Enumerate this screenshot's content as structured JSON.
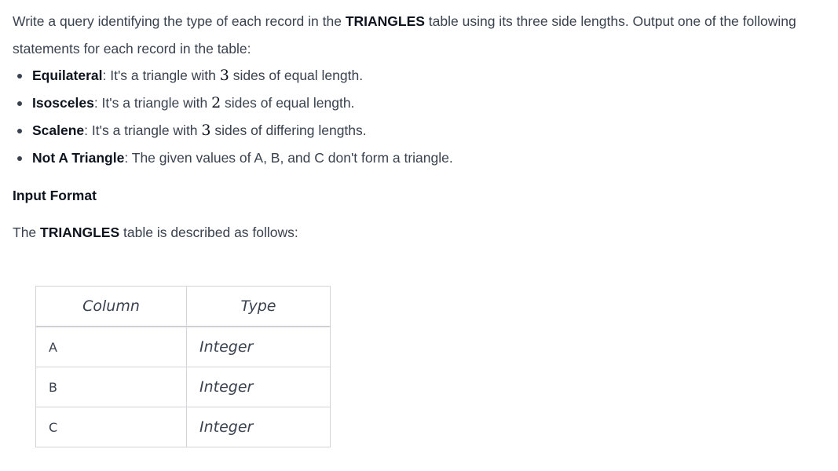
{
  "intro": {
    "text_before": "Write a query identifying the type of each record in the ",
    "table_name": "TRIANGLES",
    "text_after": " table using its three side lengths. Output one of the following statements for each record in the table:"
  },
  "types": [
    {
      "name": "Equilateral",
      "sep": ": ",
      "desc_before": "It's a triangle with ",
      "number": "3",
      "desc_after": " sides of equal length."
    },
    {
      "name": "Isosceles",
      "sep": ": ",
      "desc_before": "It's a triangle with ",
      "number": "2",
      "desc_after": " sides of equal length."
    },
    {
      "name": "Scalene",
      "sep": ": ",
      "desc_before": "It's a triangle with ",
      "number": "3",
      "desc_after": " sides of differing lengths."
    },
    {
      "name": "Not A Triangle",
      "sep": ": ",
      "desc_before": "The given values of A, B, and C don't form a triangle.",
      "number": "",
      "desc_after": ""
    }
  ],
  "input_format": {
    "heading": "Input Format",
    "desc_before": "The ",
    "table_name": "TRIANGLES",
    "desc_after": " table is described as follows:"
  },
  "schema_table": {
    "headers": [
      "Column",
      "Type"
    ],
    "rows": [
      {
        "column": "A",
        "type": "Integer"
      },
      {
        "column": "B",
        "type": "Integer"
      },
      {
        "column": "C",
        "type": "Integer"
      }
    ]
  }
}
